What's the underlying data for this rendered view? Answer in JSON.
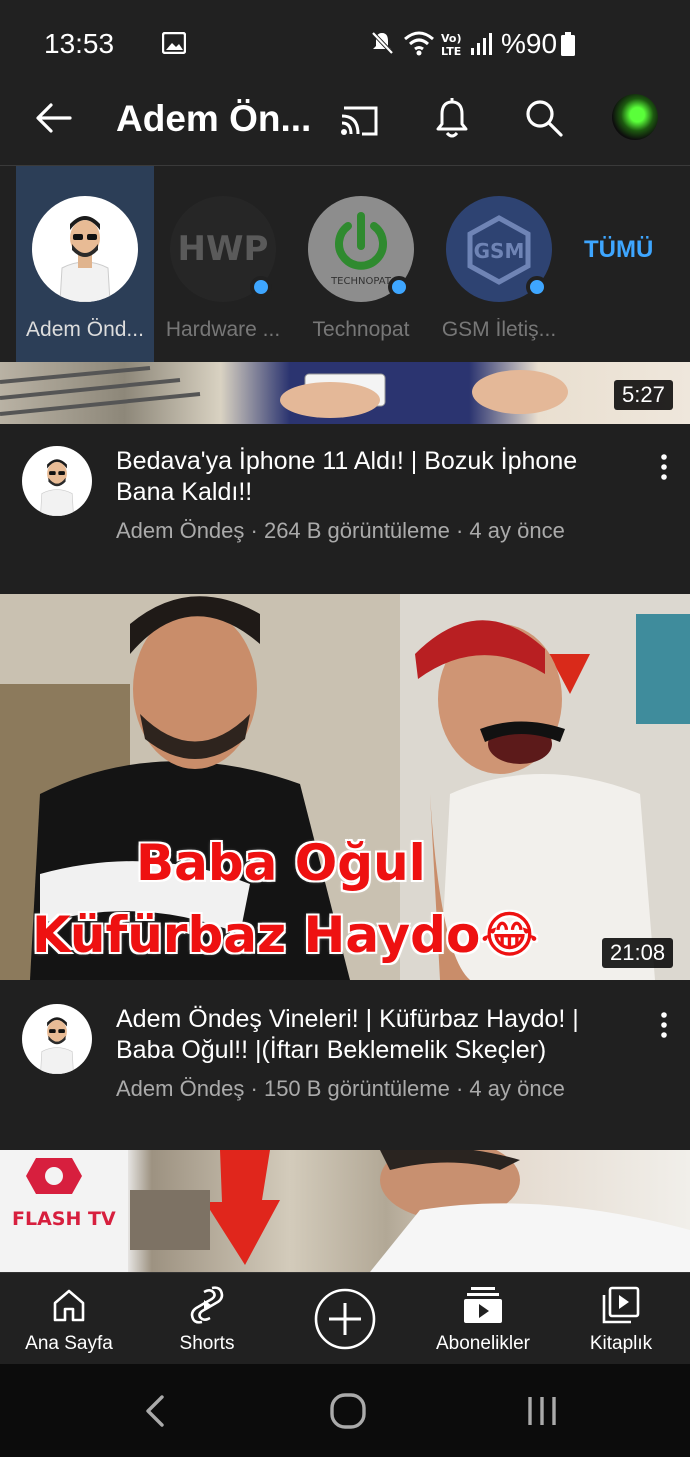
{
  "status_bar": {
    "time": "13:53",
    "battery": "%90",
    "icons": [
      "gallery-icon",
      "mute-icon",
      "wifi-icon",
      "volte-icon",
      "signal-icon",
      "battery-icon"
    ]
  },
  "app_bar": {
    "title": "Adem Ön...",
    "icons": [
      "back-arrow-icon",
      "cast-icon",
      "bell-icon",
      "search-icon",
      "account-avatar"
    ]
  },
  "channels": {
    "items": [
      {
        "name": "Adem Önd...",
        "active": true
      },
      {
        "name": "Hardware ...",
        "active": false
      },
      {
        "name": "Technopat",
        "active": false
      },
      {
        "name": "GSM İletiş...",
        "active": false
      }
    ],
    "all_label": "TÜMÜ"
  },
  "videos": [
    {
      "duration": "5:27",
      "title": "Bedava'ya İphone 11 Aldı! | Bozuk İphone Bana Kaldı!!",
      "meta": "Adem Öndeş · 264 B görüntüleme · 4 ay önce"
    },
    {
      "duration": "21:08",
      "thumb_line1": "Baba Oğul",
      "thumb_line2": "Küfürbaz Haydo😂",
      "title": "Adem Öndeş Vineleri! | Küfürbaz Haydo! | Baba Oğul!! |(İftarı Beklemelik Skeçler)",
      "meta": "Adem Öndeş · 150 B görüntüleme · 4 ay önce"
    },
    {
      "thumb_logo": "FLASH TV"
    }
  ],
  "bottom_nav": {
    "items": [
      {
        "label": "Ana Sayfa",
        "icon": "home-icon"
      },
      {
        "label": "Shorts",
        "icon": "shorts-icon"
      },
      {
        "label": "",
        "icon": "create-plus-icon"
      },
      {
        "label": "Abonelikler",
        "icon": "subscriptions-icon"
      },
      {
        "label": "Kitaplık",
        "icon": "library-icon"
      }
    ]
  },
  "colors": {
    "background": "#202020",
    "bar": "#212121",
    "accent": "#3ea6ff",
    "active_channel_bg": "#2c3e57"
  }
}
